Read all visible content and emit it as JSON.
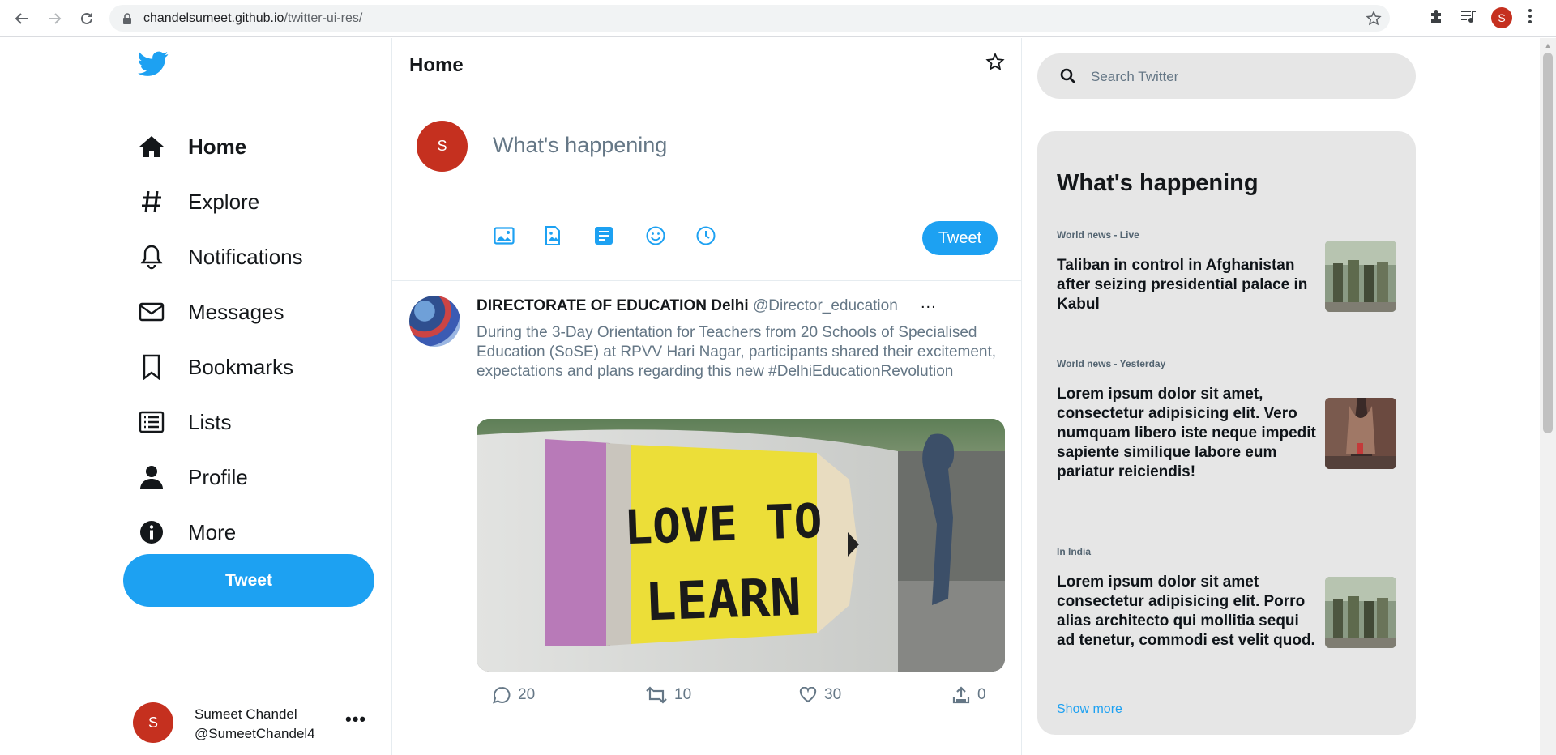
{
  "browser": {
    "url_host": "chandelsumeet.github.io",
    "url_path": "/twitter-ui-res/",
    "profile_initial": "S"
  },
  "sidebar": {
    "items": [
      {
        "label": "Home",
        "icon": "home-icon"
      },
      {
        "label": "Explore",
        "icon": "hashtag-icon"
      },
      {
        "label": "Notifications",
        "icon": "bell-icon"
      },
      {
        "label": "Messages",
        "icon": "envelope-icon"
      },
      {
        "label": "Bookmarks",
        "icon": "bookmark-icon"
      },
      {
        "label": "Lists",
        "icon": "list-icon"
      },
      {
        "label": "Profile",
        "icon": "user-icon"
      },
      {
        "label": "More",
        "icon": "info-icon"
      }
    ],
    "tweet_button": "Tweet",
    "account": {
      "initial": "S",
      "name": "Sumeet Chandel",
      "handle": "@SumeetChandel4",
      "more": "•••"
    }
  },
  "feed": {
    "title": "Home",
    "compose": {
      "avatar_initial": "S",
      "placeholder": "What's happening",
      "tweet_button": "Tweet"
    },
    "tweet": {
      "author": "DIRECTORATE OF EDUCATION Delhi",
      "handle": "@Director_education",
      "more": "...",
      "text": "During the 3-Day Orientation for Teachers from 20 Schools of Specialised Education (SoSE) at RPVV Hari Nagar, participants shared their excitement, expectations and plans regarding this new #DelhiEducationRevolution",
      "image_text_line1": "LOVE TO",
      "image_text_line2": "LEARN",
      "replies": "20",
      "retweets": "10",
      "likes": "30",
      "shares": "0"
    }
  },
  "right": {
    "search_placeholder": "Search Twitter",
    "trends_title": "What's happening",
    "trends": [
      {
        "category": "World news - Live",
        "title": "Taliban in control in Afghanistan after seizing presidential palace in Kabul"
      },
      {
        "category": "World news - Yesterday",
        "title": "Lorem ipsum dolor sit amet, consectetur adipisicing elit. Vero numquam libero iste neque impedit sapiente similique labore eum pariatur reiciendis!"
      },
      {
        "category": "In India",
        "title": "Lorem ipsum dolor sit amet consectetur adipisicing elit. Porro alias architecto qui mollitia sequi ad tenetur, commodi est velit quod."
      }
    ],
    "show_more": "Show more"
  },
  "colors": {
    "brand": "#1da1f2",
    "avatar": "#c5301f",
    "panel": "#e6e6e6"
  }
}
